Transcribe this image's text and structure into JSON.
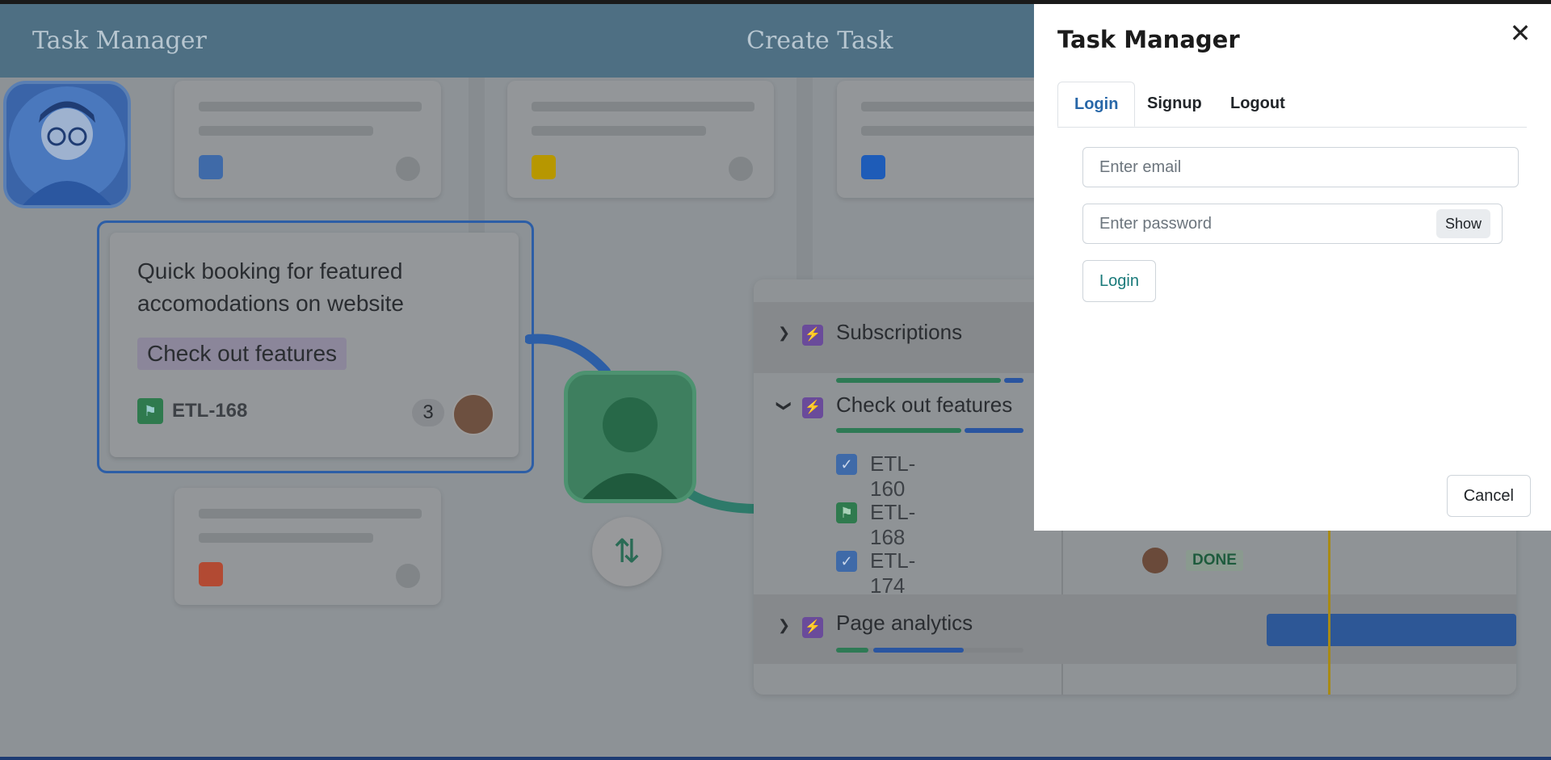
{
  "background": {
    "app_title": "Task Manager",
    "create_title": "Create Task",
    "issue_card": {
      "title": "Quick booking for featured accomodations on website",
      "tag": "Check out features",
      "key": "ETL-168",
      "comment_count": "3"
    },
    "panel": {
      "rows": [
        {
          "name": "Subscriptions",
          "expanded": false
        },
        {
          "name": "Check out features",
          "expanded": true
        },
        {
          "name": "Page analytics",
          "expanded": false
        }
      ],
      "subitems": [
        {
          "key": "ETL-160",
          "type": "task"
        },
        {
          "key": "ETL-168",
          "type": "story"
        },
        {
          "key": "ETL-174",
          "type": "task"
        }
      ],
      "status": "DONE"
    },
    "mini_card_colors": [
      "#3f6aa8",
      "#b79700",
      "#1e5cb8",
      "#b24a33"
    ]
  },
  "dialog": {
    "title": "Task Manager",
    "close_icon": "close-icon",
    "tabs": [
      "Login",
      "Signup",
      "Logout"
    ],
    "active_tab": "Login",
    "email_placeholder": "Enter email",
    "password_placeholder": "Enter password",
    "show_label": "Show",
    "login_label": "Login",
    "cancel_label": "Cancel"
  }
}
